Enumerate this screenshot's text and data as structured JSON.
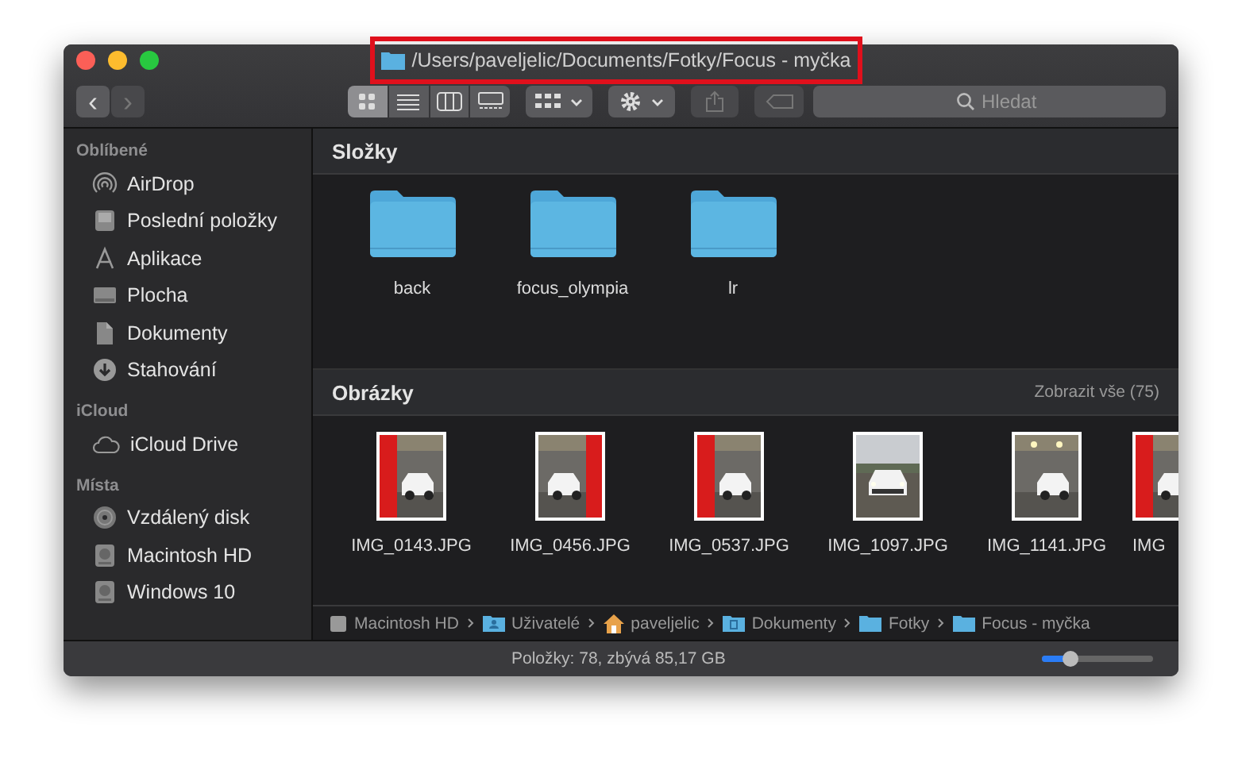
{
  "window": {
    "title": "/Users/paveljelic/Documents/Fotky/Focus - myčka",
    "title_highlighted": true
  },
  "toolbar": {
    "back": {
      "label": "‹",
      "disabled": false
    },
    "forward": {
      "label": "›",
      "disabled": true
    },
    "view_modes": [
      {
        "selected": true
      },
      {
        "selected": false
      },
      {
        "selected": false
      },
      {
        "selected": false
      }
    ],
    "share_disabled": true,
    "tag_disabled": true,
    "search": {
      "placeholder": "Hledat"
    }
  },
  "sidebar": {
    "sections": [
      {
        "title": "Oblíbené",
        "items": [
          "AirDrop",
          "Poslední položky",
          "Aplikace",
          "Plocha",
          "Dokumenty",
          "Stahování"
        ]
      },
      {
        "title": "iCloud",
        "items": [
          "iCloud Drive"
        ]
      },
      {
        "title": "Místa",
        "items": [
          "Vzdálený disk",
          "Macintosh HD",
          "Windows 10"
        ]
      }
    ]
  },
  "folders": {
    "title": "Složky",
    "items": [
      "back",
      "focus_olympia",
      "lr"
    ]
  },
  "images": {
    "title": "Obrázky",
    "show_all": "Zobrazit vše (75)",
    "items": [
      "IMG_0143.JPG",
      "IMG_0456.JPG",
      "IMG_0537.JPG",
      "IMG_1097.JPG",
      "IMG_1141.JPG",
      "IMG"
    ]
  },
  "path_bar": [
    "Macintosh HD",
    "Uživatelé",
    "paveljelic",
    "Dokumenty",
    "Fotky",
    "Focus - myčka"
  ],
  "status_bar": {
    "text": "Položky: 78, zbývá 85,17 GB",
    "zoom": {
      "level": 0.25
    }
  }
}
